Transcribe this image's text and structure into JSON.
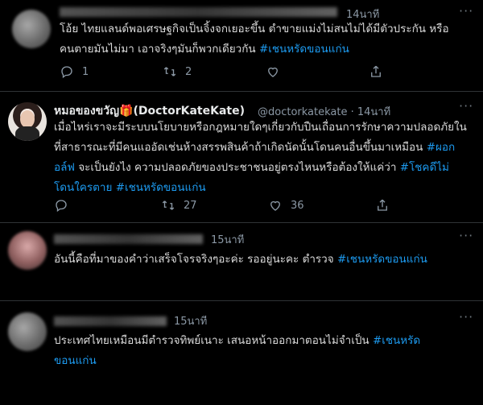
{
  "tweets": [
    {
      "time": "14นาที",
      "text": "โอ้ย ไทยแลนด์พอเศรษฐกิจเป็นจิ้งจกเยอะขึ้น ตำขายแม่งไม่สนไม่ได้มีตัวประกัน หรือคนตายมันไม่มา เอาจริงๆมันก็พวกเดียวกัน",
      "hashtags": [
        "#เชนหรัดขอนแก่น"
      ],
      "replies": "1",
      "retweets": "2",
      "likes": ""
    },
    {
      "name": "หมอของขวัญ🎁(DoctorKateKate)",
      "handle": "@doctorkatekate · 14นาที",
      "text": "เมื่อไหร่เราจะมีระบบนโยบายหรือกฎหมายใดๆเกี่ยวกับปืนเถื่อนการรักษาความปลอดภัยในที่สาธารณะที่มีคนแออัดเช่นห้างสรรพสินค้าถ้าเกิดนัดนั้นโดนคนอื่นขึ้นมาเหมือน",
      "hashtags": [
        "#ผอกอล์ฟ",
        "#โชคดีไม่โดนใครตาย",
        "#เชนหรัดขอนแก่น"
      ],
      "mid_text": "จะเป็นยังไง ความปลอดภัยของประชาชนอยู่ตรงไหนหรือต้องให้แค่ว่า",
      "replies": "",
      "retweets": "27",
      "likes": "36"
    },
    {
      "time": "15นาที",
      "text": "อันนี้คือที่มาของคำว่าเสร็จโจรจริงๆอะค่ะ รออยู่นะคะ ตำรวจ",
      "hashtags": [
        "#เชนหรัดขอนแก่น"
      ]
    },
    {
      "time": "15นาที",
      "text": "ประเทศไทยเหมือนมีตำรวจทิพย์เนาะ เสนอหน้าออกมาตอนไม่จำเป็น",
      "hashtags": [
        "#เชนหรัด",
        "ขอนแก่น"
      ]
    }
  ],
  "icons": {
    "more": "more-dots-icon",
    "reply": "reply-icon",
    "retweet": "retweet-icon",
    "like": "heart-icon",
    "share": "share-icon"
  },
  "colors": {
    "background": "#000000",
    "text": "#d9d9d9",
    "muted": "#8b98a5",
    "hashtag": "#1d9bf0",
    "divider": "#2f3336"
  }
}
